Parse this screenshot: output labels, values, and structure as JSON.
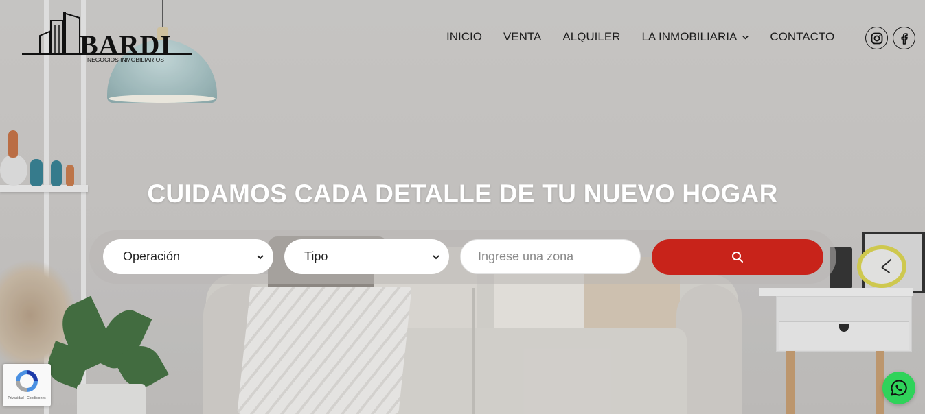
{
  "brand": {
    "name": "BARDI",
    "tagline": "NEGOCIOS INMOBILIARIOS"
  },
  "nav": {
    "items": [
      {
        "label": "INICIO"
      },
      {
        "label": "VENTA"
      },
      {
        "label": "ALQUILER"
      },
      {
        "label": "LA INMOBILIARIA",
        "has_dropdown": true
      },
      {
        "label": "CONTACTO"
      }
    ]
  },
  "social": {
    "icons": [
      "instagram-icon",
      "facebook-icon"
    ]
  },
  "hero": {
    "headline": "CUIDAMOS CADA DETALLE DE TU NUEVO HOGAR"
  },
  "search": {
    "operation_value": "Operación",
    "type_value": "Tipo",
    "zone_placeholder": "Ingrese una zona",
    "button_icon": "search-icon"
  },
  "recaptcha": {
    "text": "Privacidad - Condiciones"
  },
  "whatsapp": {
    "icon": "whatsapp-icon"
  },
  "colors": {
    "accent": "#c8231a",
    "whatsapp": "#2fd35a",
    "headline": "#ffffff",
    "nav_text": "#1d1d1d"
  }
}
